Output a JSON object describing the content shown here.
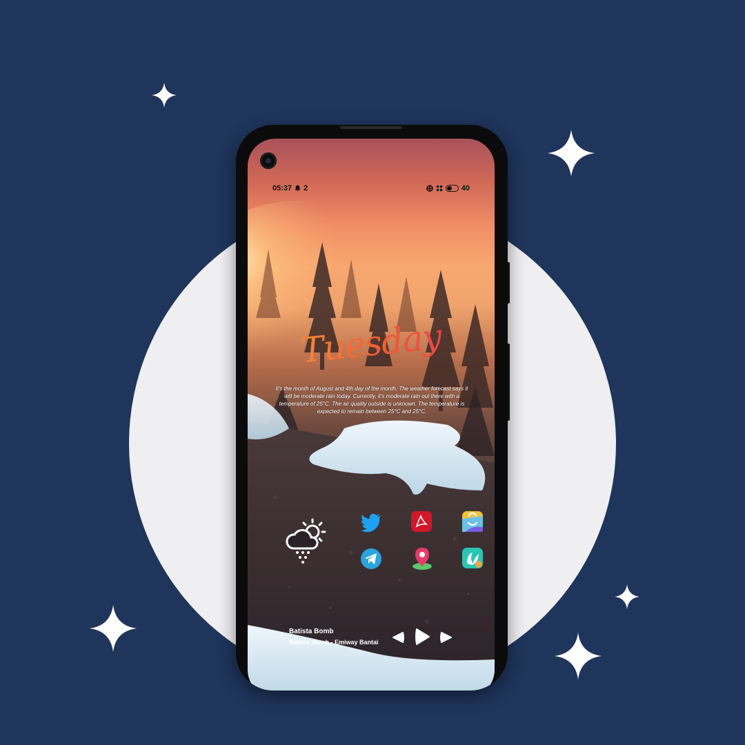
{
  "status_bar": {
    "time": "05:37",
    "notification_count": "2",
    "battery": "40"
  },
  "widget": {
    "day": "Tuesday",
    "description": "It's the month of August and 4th day of the month. The weather forecast says it will be moderate rain today. Currently, it's moderate rain out there with a temperature of 25°C. The air quality outside is unknown. The temperature is expected to remain between 25°C and 25°C."
  },
  "apps": [
    {
      "name": "Twitter",
      "icon": "twitter-icon",
      "color": "#1da1f2"
    },
    {
      "name": "Adobe Acrobat",
      "icon": "acrobat-icon",
      "color": "#d3172a"
    },
    {
      "name": "Play Store",
      "icon": "shopping-bag-icon",
      "color": "#6cc1e6"
    },
    {
      "name": "Telegram",
      "icon": "telegram-icon",
      "color": "#2aa3de"
    },
    {
      "name": "Maps",
      "icon": "map-pin-icon",
      "color": "#e53b6a"
    },
    {
      "name": "JioSaavn",
      "icon": "saavn-icon",
      "color": "#2bc5b4"
    }
  ],
  "music": {
    "title": "Batista Bomb",
    "subtitle": "Batista Bomb - Emiway Bantai"
  },
  "colors": {
    "background": "#1f355c",
    "circle": "#efeff1",
    "sky_top": "#a9515a",
    "sky_glow": "#f7a870"
  }
}
